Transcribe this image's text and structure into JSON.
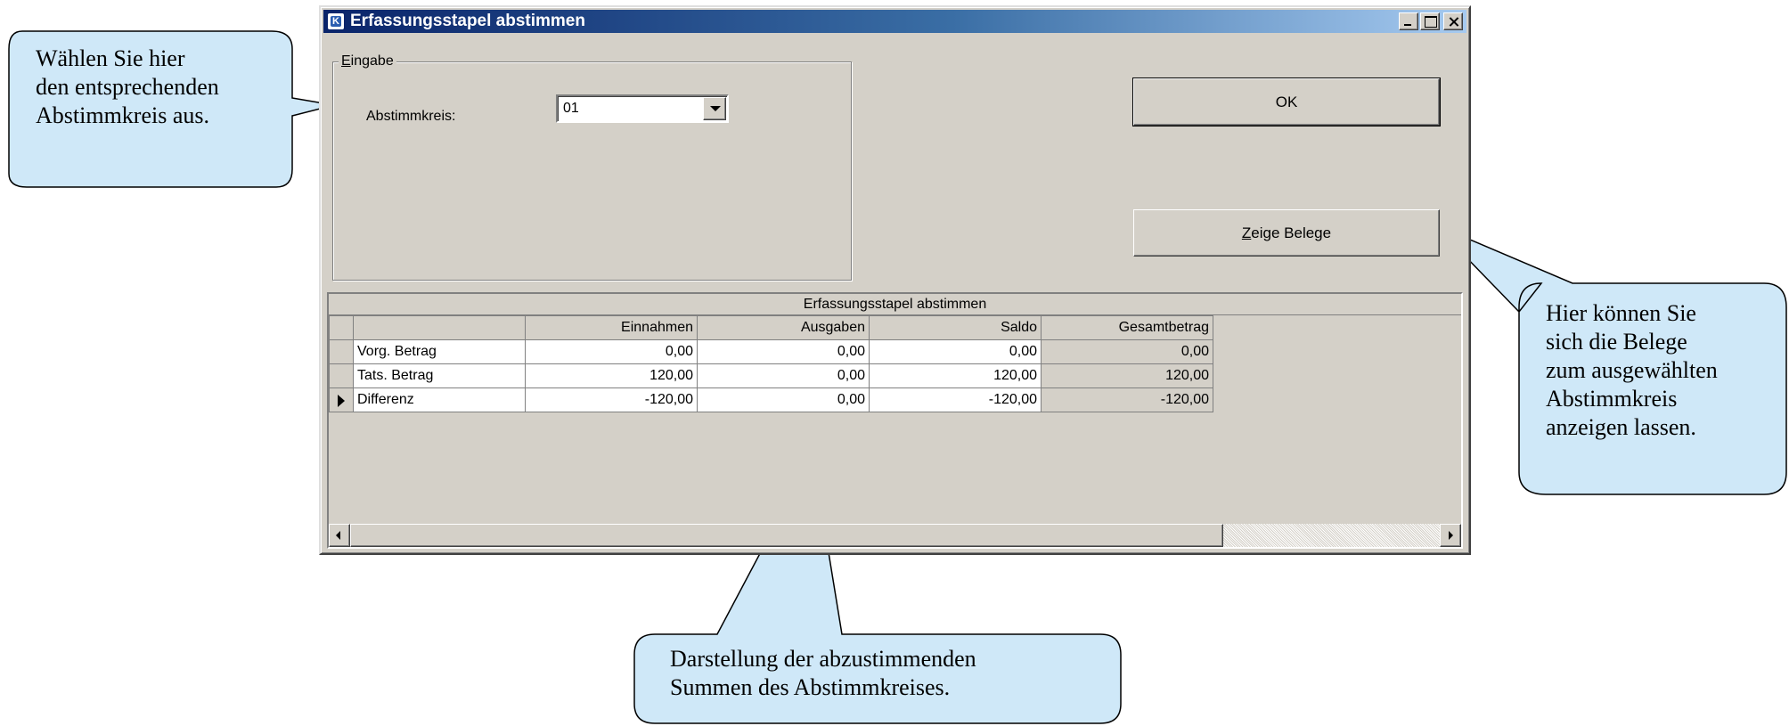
{
  "window": {
    "title": "Erfassungsstapel abstimmen",
    "icon": "app-icon",
    "icon_glyph": "K"
  },
  "input_group": {
    "legend_accel": "E",
    "legend_rest": "ingabe",
    "label": "Abstimmkreis:",
    "combo_value": "01"
  },
  "buttons": {
    "ok": "OK",
    "zeige_accel": "Z",
    "zeige_rest": "eige Belege"
  },
  "grid": {
    "caption": "Erfassungsstapel abstimmen",
    "columns": [
      "",
      "Einnahmen",
      "Ausgaben",
      "Saldo",
      "Gesamtbetrag"
    ],
    "rows": [
      {
        "label": "Vorg. Betrag",
        "einnahmen": "0,00",
        "ausgaben": "0,00",
        "saldo": "0,00",
        "gesamt": "0,00"
      },
      {
        "label": "Tats. Betrag",
        "einnahmen": "120,00",
        "ausgaben": "0,00",
        "saldo": "120,00",
        "gesamt": "120,00"
      },
      {
        "label": "Differenz",
        "einnahmen": "-120,00",
        "ausgaben": "0,00",
        "saldo": "-120,00",
        "gesamt": "-120,00"
      }
    ],
    "current_row": 2
  },
  "callouts": {
    "abstimmkreis": [
      "Wählen Sie hier",
      "den entsprechenden",
      "Abstimmkreis aus."
    ],
    "belege": [
      "Hier können Sie",
      "sich die Belege",
      "zum ausgewählten",
      "Abstimmkreis",
      "anzeigen lassen."
    ],
    "summen": [
      "Darstellung der abzustimmenden",
      "Summen des Abstimmkreises."
    ]
  },
  "colors": {
    "window_bg": "#d4d0c8",
    "titlebar_start": "#0a246a",
    "titlebar_end": "#a6caf0",
    "callout_fill": "#cfe8f8"
  }
}
